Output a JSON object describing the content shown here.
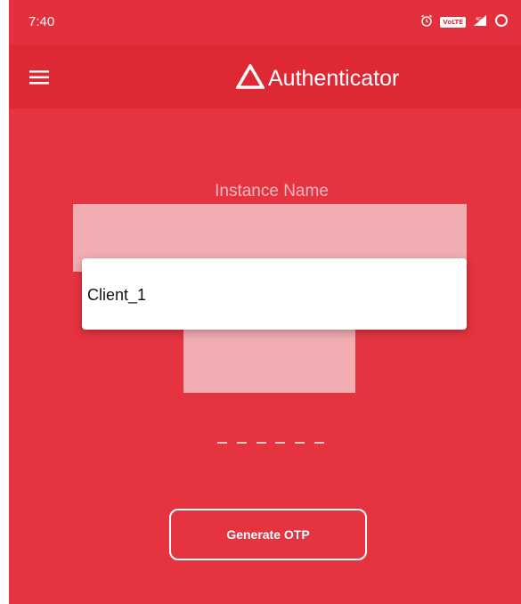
{
  "status_bar": {
    "time": "7:40",
    "volte_label": "VoLTE",
    "icons": [
      "alarm-icon",
      "volte-icon",
      "signal-icon",
      "data-saver-icon"
    ]
  },
  "app_bar": {
    "title": "Authenticator",
    "menu_icon": "hamburger-menu-icon",
    "logo_icon": "triangle-logo-icon"
  },
  "form": {
    "instance_label": "Instance Name",
    "dropdown_options": [
      "Client_1"
    ],
    "otp_placeholder_digits": 6,
    "generate_button_label": "Generate OTP"
  },
  "colors": {
    "primary": "#e53440",
    "app_bar": "#de2834",
    "field_ghost": "#f2adb2",
    "text_on_primary": "#ffffff"
  }
}
